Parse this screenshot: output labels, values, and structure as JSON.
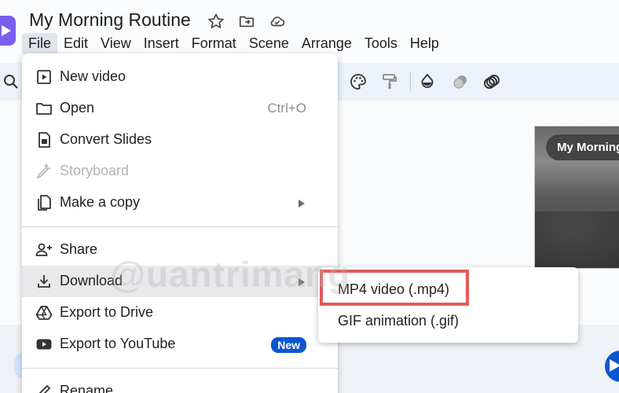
{
  "app": {
    "title": "My Morning Routine"
  },
  "menubar": {
    "items": [
      "File",
      "Edit",
      "View",
      "Insert",
      "Format",
      "Scene",
      "Arrange",
      "Tools",
      "Help"
    ]
  },
  "file_menu": {
    "items": [
      {
        "label": "New video"
      },
      {
        "label": "Open",
        "shortcut": "Ctrl+O"
      },
      {
        "label": "Convert Slides"
      },
      {
        "label": "Storyboard"
      },
      {
        "label": "Make a copy"
      },
      {
        "label": "Share"
      },
      {
        "label": "Download"
      },
      {
        "label": "Export to Drive"
      },
      {
        "label": "Export to YouTube",
        "badge": "New"
      },
      {
        "label": "Rename"
      }
    ]
  },
  "download_submenu": {
    "items": [
      {
        "label": "MP4 video (.mp4)"
      },
      {
        "label": "GIF animation (.gif)"
      }
    ]
  },
  "preview": {
    "title_overlay": "My Morning"
  },
  "watermark": {
    "text": "@uantrimang"
  },
  "colors": {
    "accent_purple": "#7b5cf0",
    "new_badge": "#0b57d0",
    "highlight_box": "#e25a5a",
    "menu_hover": "#e9e9eb"
  }
}
